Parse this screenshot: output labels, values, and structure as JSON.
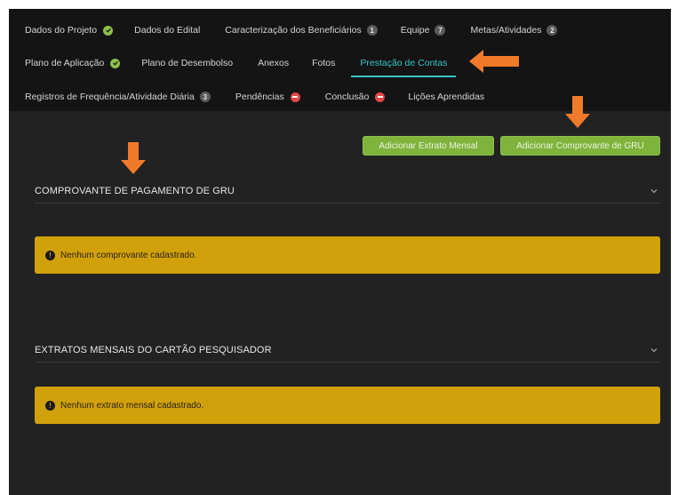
{
  "tabs": {
    "row1": [
      {
        "label": "Dados do Projeto",
        "status": "ok"
      },
      {
        "label": "Dados do Edital"
      },
      {
        "label": "Caracterização dos Beneficiários",
        "badge": "1"
      },
      {
        "label": "Equipe",
        "badge": "7"
      },
      {
        "label": "Metas/Atividades",
        "badge": "2"
      }
    ],
    "row2": [
      {
        "label": "Plano de Aplicação",
        "status": "ok"
      },
      {
        "label": "Plano de Desembolso"
      },
      {
        "label": "Anexos"
      },
      {
        "label": "Fotos"
      },
      {
        "label": "Prestação de Contas",
        "active": true
      }
    ],
    "row3": [
      {
        "label": "Registros de Frequência/Atividade Diária",
        "badge": "3"
      },
      {
        "label": "Pendências",
        "status": "error"
      },
      {
        "label": "Conclusão",
        "status": "error"
      },
      {
        "label": "Lições Aprendidas"
      }
    ]
  },
  "buttons": {
    "add_extrato": "Adicionar Extrato Mensal",
    "add_gru": "Adicionar Comprovante de GRU"
  },
  "sections": {
    "gru": {
      "title": "COMPROVANTE DE PAGAMENTO DE GRU",
      "alert": "Nenhum comprovante cadastrado."
    },
    "extratos": {
      "title": "EXTRATOS MENSAIS DO CARTÃO PESQUISADOR",
      "alert": "Nenhum extrato mensal cadastrado."
    }
  },
  "colors": {
    "accent": "#39c3c3",
    "button": "#7fb33c",
    "warning": "#d1a10c",
    "arrow": "#f07a2a",
    "ok": "#8fc04a",
    "error": "#e04848"
  }
}
